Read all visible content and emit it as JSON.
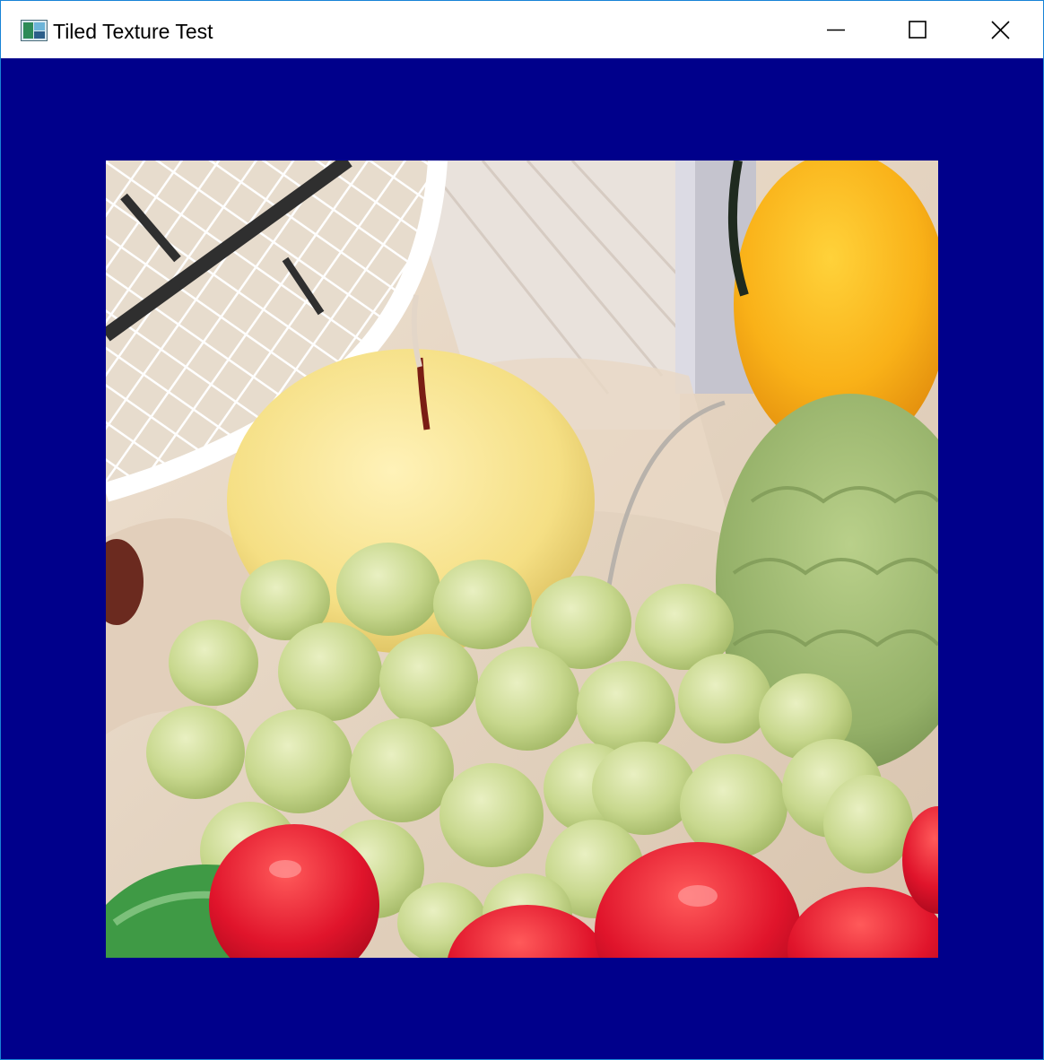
{
  "window": {
    "title": "Tiled Texture Test",
    "app_icon": "app-window-icon",
    "controls": {
      "minimize_icon": "minimize-icon",
      "maximize_icon": "maximize-icon",
      "close_icon": "close-icon"
    }
  },
  "colors": {
    "title_bar": "#ffffff",
    "window_border": "#1883d7",
    "client_background": "#00008b"
  },
  "texture": {
    "subject": "fruit still life: yellow apple, green grapes, red tomatoes, orange mango, custard apple, white basket"
  }
}
